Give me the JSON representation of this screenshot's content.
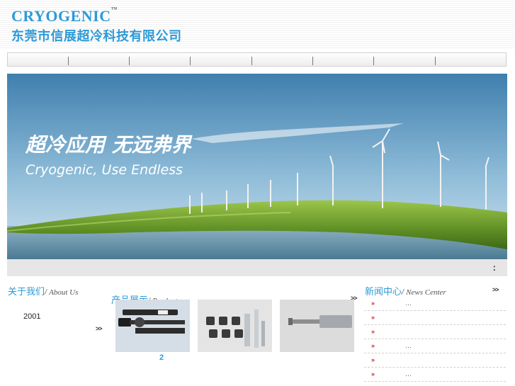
{
  "header": {
    "logo_en": "CRYOGENIC",
    "logo_tm": "™",
    "company_cn": "东莞市信展超冷科技有限公司"
  },
  "banner": {
    "slogan_cn": "超冷应用  无远弗界",
    "slogan_en": "Cryogenic, Use Endless",
    "bar_text": ":"
  },
  "about": {
    "title_cn": "关于我们",
    "title_en": "About Us",
    "year": "2001",
    "more": ">>"
  },
  "products": {
    "title_cn": "产品展示",
    "title_en": "Products",
    "more": ">>",
    "caption": "2"
  },
  "news": {
    "title_cn": "新闻中心",
    "title_en": "News Center",
    "more": ">>",
    "items": [
      {
        "arrow": "»",
        "text": "…"
      },
      {
        "arrow": "»",
        "text": ""
      },
      {
        "arrow": "»",
        "text": ""
      },
      {
        "arrow": "»",
        "text": "…"
      },
      {
        "arrow": "»",
        "text": ""
      },
      {
        "arrow": "»",
        "text": "…"
      }
    ]
  },
  "colors": {
    "brand_blue": "#2e9ad6",
    "news_arrow": "#d02020"
  }
}
